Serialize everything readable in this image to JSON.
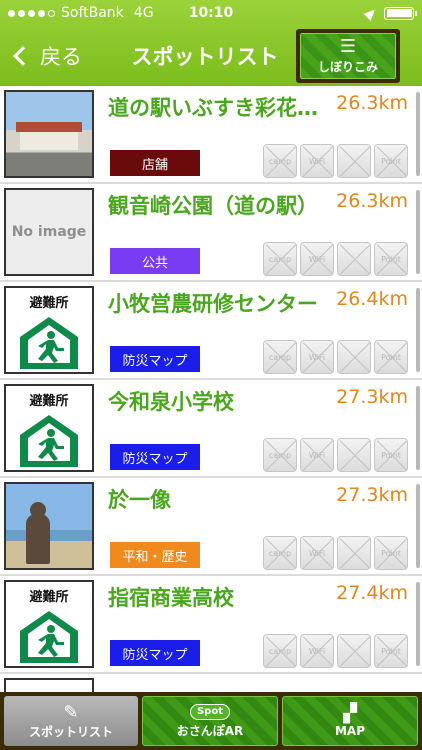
{
  "status_bar": {
    "carrier": "SoftBank",
    "network": "4G",
    "time": "10:10",
    "battery_level": 1.0
  },
  "nav": {
    "back_label": "戻る",
    "title": "スポットリスト",
    "filter_label": "しぼりこみ"
  },
  "feature_icons": [
    "camp-icon",
    "wifi-off-icon",
    "toilet-icon",
    "point-icon"
  ],
  "feature_icon_labels": [
    "camp",
    "WiFi",
    "",
    "Point"
  ],
  "items": [
    {
      "title": "道の駅いぶすき彩花…",
      "distance": "26.3km",
      "category": "店舗",
      "category_color": "#6b0a0a",
      "thumb": "photo-building"
    },
    {
      "title": "観音崎公園（道の駅）",
      "distance": "26.3km",
      "category": "公共",
      "category_color": "#7a3cf2",
      "thumb": "no-image",
      "thumb_text": "No image"
    },
    {
      "title": "小牧営農研修センター",
      "distance": "26.4km",
      "category": "防災マップ",
      "category_color": "#1a1ee8",
      "thumb": "evacuation",
      "thumb_text": "避難所"
    },
    {
      "title": "今和泉小学校",
      "distance": "27.3km",
      "category": "防災マップ",
      "category_color": "#1a1ee8",
      "thumb": "evacuation",
      "thumb_text": "避難所"
    },
    {
      "title": "於一像",
      "distance": "27.3km",
      "category": "平和・歴史",
      "category_color": "#f08a1c",
      "thumb": "photo-statue"
    },
    {
      "title": "指宿商業高校",
      "distance": "27.4km",
      "category": "防災マップ",
      "category_color": "#1a1ee8",
      "thumb": "evacuation",
      "thumb_text": "避難所"
    }
  ],
  "tabs": [
    {
      "label": "スポットリスト",
      "icon": "edit-icon"
    },
    {
      "label": "おさんぽAR",
      "icon": "spot-bubble-icon",
      "badge": "Spot"
    },
    {
      "label": "MAP",
      "icon": "map-blocks-icon"
    }
  ]
}
